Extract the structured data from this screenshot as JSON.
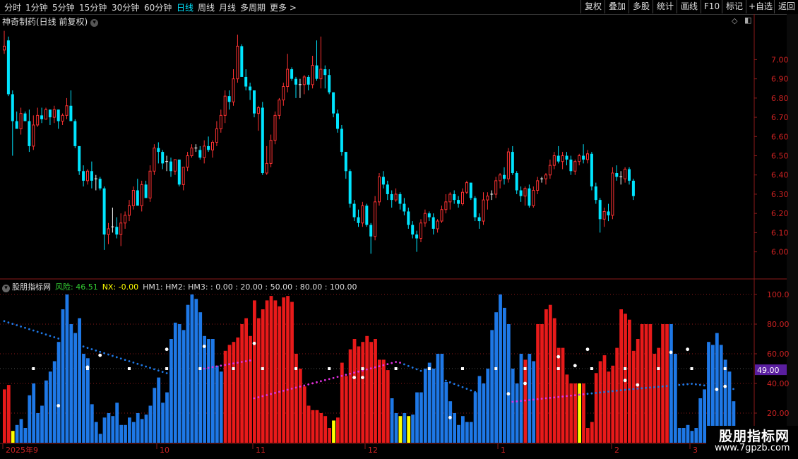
{
  "toolbar": {
    "periods": [
      "分时",
      "1分钟",
      "5分钟",
      "15分钟",
      "30分钟",
      "60分钟",
      "日线",
      "周线",
      "月线",
      "多周期",
      "更多 >"
    ],
    "active_period": "日线",
    "right_buttons": [
      "复权",
      "叠加",
      "多股",
      "统计",
      "画线",
      "F10",
      "标记",
      "+自选",
      "返回"
    ]
  },
  "chart_title": "神奇制药(日线 前复权)",
  "price_axis": {
    "ticks": [
      "7.00",
      "6.90",
      "6.80",
      "6.70",
      "6.60",
      "6.50",
      "6.40",
      "6.30",
      "6.20",
      "6.10",
      "6.00"
    ]
  },
  "indicator": {
    "name": "股朋指标网",
    "risk_label": "风险: 46.51",
    "nx_label": "NX: -0.00",
    "hm_labels": "HM1: HM2: HM3: : 0.00 : 20.00 : 50.00 : 80.00 : 100.00",
    "axis_ticks": [
      "100.0",
      "80.00",
      "60.00",
      "40.00",
      "20.00"
    ],
    "current_value": "49.00"
  },
  "date_axis": [
    "2025年9",
    "10",
    "11",
    "12",
    "1",
    "2",
    "3"
  ],
  "logo": {
    "line1": "股朋指标网",
    "line2": "www.7gpzb.com"
  },
  "colors": {
    "up": "#ff3232",
    "down": "#00e5ff",
    "bar_red": "#e81a1a",
    "bar_blue": "#1e78e6",
    "bar_yellow": "#ffff00",
    "ma_magenta": "#e030e0",
    "ma_blue": "#1e78e6"
  },
  "chart_data": [
    {
      "type": "candlestick",
      "title": "神奇制药(日线 前复权)",
      "ylim": [
        5.87,
        7.2
      ],
      "ohlc": [
        [
          7.05,
          7.15,
          7.03,
          7.07
        ],
        [
          7.1,
          7.12,
          6.81,
          6.82
        ],
        [
          6.82,
          6.84,
          6.5,
          6.68
        ],
        [
          6.68,
          6.73,
          6.65,
          6.64
        ],
        [
          6.64,
          6.75,
          6.61,
          6.72
        ],
        [
          6.72,
          6.73,
          6.69,
          6.68
        ],
        [
          6.68,
          6.74,
          6.52,
          6.55
        ],
        [
          6.55,
          6.71,
          6.53,
          6.66
        ],
        [
          6.66,
          6.75,
          6.65,
          6.71
        ],
        [
          6.71,
          6.75,
          6.67,
          6.69
        ],
        [
          6.69,
          6.75,
          6.7,
          6.74
        ],
        [
          6.74,
          6.74,
          6.66,
          6.7
        ],
        [
          6.7,
          6.76,
          6.67,
          6.74
        ],
        [
          6.74,
          6.74,
          6.64,
          6.68
        ],
        [
          6.68,
          6.72,
          6.66,
          6.71
        ],
        [
          6.71,
          6.8,
          6.69,
          6.76
        ],
        [
          6.76,
          6.84,
          6.69,
          6.68
        ],
        [
          6.68,
          6.69,
          6.54,
          6.55
        ],
        [
          6.55,
          6.55,
          6.4,
          6.42
        ],
        [
          6.42,
          6.45,
          6.34,
          6.37
        ],
        [
          6.37,
          6.43,
          6.35,
          6.42
        ],
        [
          6.42,
          6.47,
          6.33,
          6.37
        ],
        [
          6.37,
          6.4,
          6.32,
          6.38
        ],
        [
          6.38,
          6.39,
          6.32,
          6.33
        ],
        [
          6.33,
          6.34,
          6.01,
          6.09
        ],
        [
          6.09,
          6.15,
          6.04,
          6.12
        ],
        [
          6.12,
          6.23,
          6.1,
          6.13
        ],
        [
          6.13,
          6.18,
          6.07,
          6.09
        ],
        [
          6.09,
          6.2,
          6.03,
          6.15
        ],
        [
          6.15,
          6.21,
          6.12,
          6.19
        ],
        [
          6.19,
          6.27,
          6.16,
          6.24
        ],
        [
          6.24,
          6.34,
          6.22,
          6.32
        ],
        [
          6.32,
          6.38,
          6.28,
          6.24
        ],
        [
          6.24,
          6.37,
          6.21,
          6.35
        ],
        [
          6.35,
          6.37,
          6.29,
          6.28
        ],
        [
          6.28,
          6.45,
          6.26,
          6.42
        ],
        [
          6.42,
          6.56,
          6.4,
          6.54
        ],
        [
          6.54,
          6.57,
          6.46,
          6.52
        ],
        [
          6.52,
          6.53,
          6.43,
          6.46
        ],
        [
          6.46,
          6.5,
          6.42,
          6.47
        ],
        [
          6.47,
          6.49,
          6.39,
          6.42
        ],
        [
          6.42,
          6.48,
          6.4,
          6.48
        ],
        [
          6.48,
          6.48,
          6.34,
          6.35
        ],
        [
          6.35,
          6.38,
          6.32,
          6.44
        ],
        [
          6.44,
          6.52,
          6.42,
          6.5
        ],
        [
          6.5,
          6.56,
          6.49,
          6.54
        ],
        [
          6.54,
          6.56,
          6.52,
          6.53
        ],
        [
          6.53,
          6.55,
          6.48,
          6.49
        ],
        [
          6.49,
          6.58,
          6.46,
          6.55
        ],
        [
          6.55,
          6.6,
          6.52,
          6.53
        ],
        [
          6.53,
          6.58,
          6.49,
          6.57
        ],
        [
          6.57,
          6.68,
          6.55,
          6.64
        ],
        [
          6.64,
          6.74,
          6.62,
          6.71
        ],
        [
          6.71,
          6.84,
          6.67,
          6.81
        ],
        [
          6.81,
          6.84,
          6.74,
          6.78
        ],
        [
          6.78,
          6.95,
          6.76,
          6.9
        ],
        [
          6.9,
          7.13,
          6.88,
          7.07
        ],
        [
          7.07,
          7.08,
          6.92,
          6.91
        ],
        [
          6.91,
          6.95,
          6.84,
          6.86
        ],
        [
          6.86,
          6.88,
          6.79,
          6.84
        ],
        [
          6.84,
          6.84,
          6.7,
          6.72
        ],
        [
          6.72,
          6.76,
          6.63,
          6.75
        ],
        [
          6.75,
          6.78,
          6.4,
          6.41
        ],
        [
          6.41,
          6.55,
          6.4,
          6.46
        ],
        [
          6.46,
          6.61,
          6.44,
          6.58
        ],
        [
          6.58,
          6.73,
          6.56,
          6.71
        ],
        [
          6.71,
          6.8,
          6.69,
          6.79
        ],
        [
          6.79,
          6.88,
          6.76,
          6.86
        ],
        [
          6.86,
          7.03,
          6.83,
          6.95
        ],
        [
          6.95,
          6.96,
          6.89,
          6.9
        ],
        [
          6.9,
          6.91,
          6.8,
          6.87
        ],
        [
          6.87,
          6.9,
          6.8,
          6.87
        ],
        [
          6.87,
          6.92,
          6.82,
          6.91
        ],
        [
          6.91,
          6.92,
          6.84,
          6.87
        ],
        [
          6.87,
          7.02,
          6.85,
          6.97
        ],
        [
          6.97,
          7.1,
          6.89,
          6.9
        ],
        [
          6.9,
          7.12,
          6.85,
          6.95
        ],
        [
          6.95,
          6.97,
          6.85,
          6.92
        ],
        [
          6.92,
          6.95,
          6.82,
          6.83
        ],
        [
          6.83,
          6.83,
          6.7,
          6.72
        ],
        [
          6.72,
          6.74,
          6.62,
          6.64
        ],
        [
          6.64,
          6.66,
          6.5,
          6.52
        ],
        [
          6.52,
          6.52,
          6.38,
          6.42
        ],
        [
          6.42,
          6.43,
          6.23,
          6.25
        ],
        [
          6.25,
          6.27,
          6.16,
          6.18
        ],
        [
          6.18,
          6.22,
          6.13,
          6.15
        ],
        [
          6.15,
          6.26,
          6.13,
          6.24
        ],
        [
          6.24,
          6.25,
          6.13,
          6.14
        ],
        [
          6.14,
          6.15,
          5.99,
          6.08
        ],
        [
          6.08,
          6.29,
          6.06,
          6.26
        ],
        [
          6.26,
          6.41,
          6.24,
          6.39
        ],
        [
          6.39,
          6.42,
          6.33,
          6.35
        ],
        [
          6.35,
          6.37,
          6.27,
          6.3
        ],
        [
          6.3,
          6.32,
          6.23,
          6.27
        ],
        [
          6.27,
          6.33,
          6.26,
          6.3
        ],
        [
          6.3,
          6.31,
          6.22,
          6.25
        ],
        [
          6.25,
          6.28,
          6.19,
          6.21
        ],
        [
          6.21,
          6.23,
          6.12,
          6.14
        ],
        [
          6.14,
          6.16,
          6.07,
          6.09
        ],
        [
          6.09,
          6.11,
          6.0,
          6.07
        ],
        [
          6.07,
          6.17,
          6.05,
          6.15
        ],
        [
          6.15,
          6.22,
          6.13,
          6.2
        ],
        [
          6.2,
          6.21,
          6.16,
          6.18
        ],
        [
          6.18,
          6.2,
          6.09,
          6.12
        ],
        [
          6.12,
          6.17,
          6.1,
          6.16
        ],
        [
          6.16,
          6.24,
          6.15,
          6.22
        ],
        [
          6.22,
          6.3,
          6.2,
          6.26
        ],
        [
          6.26,
          6.31,
          6.22,
          6.3
        ],
        [
          6.3,
          6.32,
          6.25,
          6.27
        ],
        [
          6.27,
          6.29,
          6.23,
          6.25
        ],
        [
          6.25,
          6.33,
          6.24,
          6.31
        ],
        [
          6.31,
          6.37,
          6.3,
          6.36
        ],
        [
          6.36,
          6.36,
          6.27,
          6.28
        ],
        [
          6.28,
          6.29,
          6.16,
          6.18
        ],
        [
          6.18,
          6.2,
          6.12,
          6.16
        ],
        [
          6.16,
          6.31,
          6.14,
          6.27
        ],
        [
          6.27,
          6.31,
          6.22,
          6.29
        ],
        [
          6.29,
          6.32,
          6.27,
          6.3
        ],
        [
          6.3,
          6.39,
          6.28,
          6.37
        ],
        [
          6.37,
          6.41,
          6.33,
          6.4
        ],
        [
          6.4,
          6.44,
          6.35,
          6.38
        ],
        [
          6.38,
          6.54,
          6.36,
          6.52
        ],
        [
          6.52,
          6.55,
          6.4,
          6.41
        ],
        [
          6.41,
          6.42,
          6.3,
          6.32
        ],
        [
          6.32,
          6.34,
          6.26,
          6.29
        ],
        [
          6.29,
          6.34,
          6.24,
          6.33
        ],
        [
          6.33,
          6.35,
          6.23,
          6.24
        ],
        [
          6.24,
          6.34,
          6.23,
          6.32
        ],
        [
          6.32,
          6.39,
          6.3,
          6.37
        ],
        [
          6.37,
          6.39,
          6.36,
          6.38
        ],
        [
          6.38,
          6.41,
          6.35,
          6.4
        ],
        [
          6.4,
          6.48,
          6.38,
          6.45
        ],
        [
          6.45,
          6.52,
          6.43,
          6.5
        ],
        [
          6.5,
          6.55,
          6.46,
          6.47
        ],
        [
          6.47,
          6.52,
          6.43,
          6.5
        ],
        [
          6.5,
          6.52,
          6.45,
          6.48
        ],
        [
          6.48,
          6.5,
          6.4,
          6.42
        ],
        [
          6.42,
          6.48,
          6.4,
          6.47
        ],
        [
          6.47,
          6.51,
          6.45,
          6.5
        ],
        [
          6.5,
          6.56,
          6.46,
          6.48
        ],
        [
          6.48,
          6.53,
          6.46,
          6.51
        ],
        [
          6.51,
          6.52,
          6.32,
          6.34
        ],
        [
          6.34,
          6.36,
          6.25,
          6.27
        ],
        [
          6.27,
          6.28,
          6.1,
          6.17
        ],
        [
          6.17,
          6.23,
          6.13,
          6.21
        ],
        [
          6.21,
          6.25,
          6.16,
          6.19
        ],
        [
          6.19,
          6.44,
          6.17,
          6.41
        ],
        [
          6.41,
          6.45,
          6.37,
          6.39
        ],
        [
          6.39,
          6.42,
          6.35,
          6.38
        ],
        [
          6.38,
          6.44,
          6.36,
          6.43
        ],
        [
          6.43,
          6.44,
          6.35,
          6.37
        ],
        [
          6.37,
          6.38,
          6.27,
          6.29
        ]
      ]
    },
    {
      "type": "bar",
      "title": "股朋指标网",
      "ylim": [
        0,
        100
      ],
      "values": [
        36,
        39,
        8,
        12,
        16,
        10,
        32,
        40,
        20,
        25,
        42,
        48,
        55,
        68,
        90,
        100,
        80,
        74,
        84,
        60,
        57,
        26,
        14,
        6,
        17,
        20,
        18,
        27,
        12,
        12,
        17,
        14,
        20,
        16,
        19,
        25,
        37,
        44,
        27,
        34,
        70,
        81,
        80,
        76,
        93,
        100,
        97,
        88,
        72,
        70,
        70,
        52,
        48,
        62,
        66,
        68,
        71,
        80,
        84,
        72,
        96,
        84,
        90,
        96,
        99,
        96,
        92,
        98,
        99,
        95,
        60,
        50,
        38,
        25,
        22,
        22,
        20,
        18,
        10,
        15,
        17,
        54,
        45,
        63,
        70,
        65,
        68,
        72,
        68,
        70,
        56,
        56,
        49,
        30,
        20,
        18,
        20,
        18,
        19,
        34,
        34,
        50,
        54,
        50,
        60,
        60,
        41,
        28,
        20,
        12,
        18,
        14,
        14,
        34,
        45,
        40,
        50,
        76,
        88,
        100,
        91,
        80,
        50,
        40,
        60,
        56,
        60,
        55,
        80,
        80,
        90,
        93,
        84,
        64,
        64,
        46,
        40,
        40,
        40,
        40,
        10,
        14,
        47,
        55,
        59,
        48,
        52,
        64,
        90,
        87,
        83,
        62,
        70,
        80,
        80,
        80,
        60,
        64,
        80,
        80,
        80,
        60,
        10,
        10,
        12,
        8,
        10,
        30,
        36,
        68,
        66,
        74,
        66,
        56,
        48,
        28
      ],
      "bar_colors": [
        "r",
        "r",
        "y",
        "b",
        "b",
        "b",
        "b",
        "b",
        "b",
        "b",
        "b",
        "b",
        "b",
        "b",
        "b",
        "b",
        "b",
        "b",
        "b",
        "b",
        "b",
        "b",
        "b",
        "b",
        "b",
        "b",
        "b",
        "b",
        "b",
        "b",
        "b",
        "b",
        "b",
        "b",
        "b",
        "b",
        "b",
        "b",
        "b",
        "b",
        "b",
        "b",
        "b",
        "b",
        "b",
        "b",
        "b",
        "b",
        "b",
        "b",
        "b",
        "b",
        "b",
        "r",
        "r",
        "r",
        "r",
        "r",
        "r",
        "r",
        "r",
        "r",
        "r",
        "r",
        "r",
        "r",
        "r",
        "r",
        "r",
        "r",
        "r",
        "r",
        "r",
        "r",
        "r",
        "r",
        "r",
        "r",
        "r",
        "y",
        "r",
        "r",
        "r",
        "r",
        "r",
        "r",
        "r",
        "r",
        "r",
        "r",
        "r",
        "r",
        "r",
        "b",
        "b",
        "y",
        "b",
        "y",
        "b",
        "b",
        "b",
        "b",
        "b",
        "b",
        "b",
        "b",
        "b",
        "b",
        "b",
        "b",
        "b",
        "b",
        "b",
        "b",
        "b",
        "b",
        "b",
        "b",
        "b",
        "b",
        "b",
        "b",
        "b",
        "b",
        "b",
        "r",
        "b",
        "b",
        "r",
        "r",
        "r",
        "r",
        "r",
        "r",
        "r",
        "r",
        "r",
        "r",
        "y",
        "r",
        "r",
        "r",
        "r",
        "r",
        "r",
        "r",
        "r",
        "r",
        "r",
        "r",
        "r",
        "r",
        "r",
        "r",
        "r",
        "r",
        "r",
        "r",
        "r",
        "r",
        "b",
        "b",
        "b",
        "b",
        "b",
        "b",
        "b",
        "b",
        "b",
        "b",
        "b",
        "b",
        "b",
        "b",
        "b",
        "b"
      ]
    }
  ]
}
